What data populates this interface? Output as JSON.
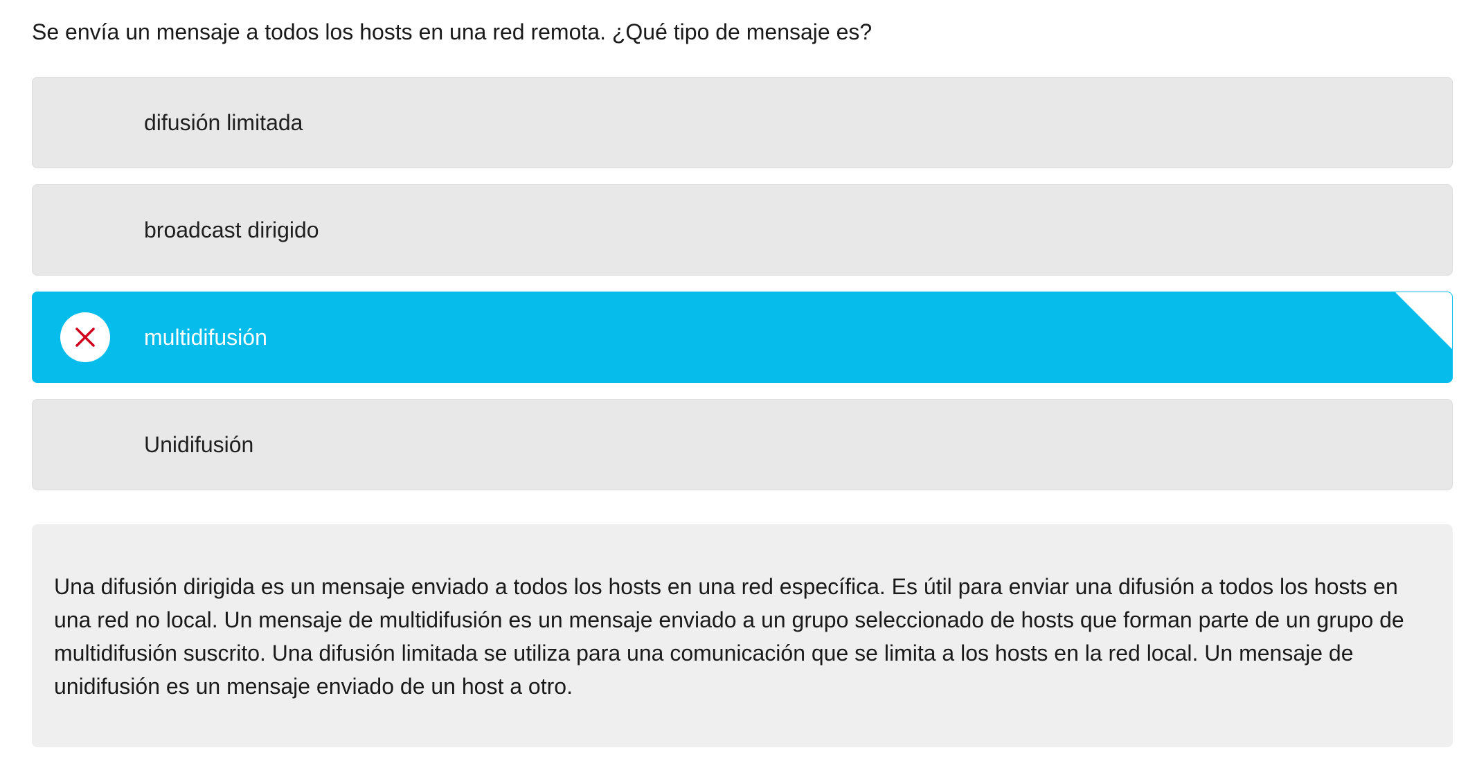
{
  "question": {
    "text": "Se envía un mensaje a todos los hosts en una red remota. ¿Qué tipo de mensaje es?"
  },
  "options": [
    {
      "label": "difusión limitada",
      "selected": false
    },
    {
      "label": "broadcast dirigido",
      "selected": false
    },
    {
      "label": "multidifusión",
      "selected": true,
      "marker_icon": "incorrect-x-icon"
    },
    {
      "label": "Unidifusión",
      "selected": false
    }
  ],
  "feedback": {
    "text": "Una difusión dirigida es un mensaje enviado a todos los hosts en una red específica. Es útil para enviar una difusión a todos los hosts en una red no local. Un mensaje de multidifusión es un mensaje enviado a un grupo seleccionado de hosts que forman parte de un grupo de multidifusión suscrito. Una difusión limitada se utiliza para una comunicación que se limita a los hosts en la red local. Un mensaje de unidifusión es un mensaje enviado de un host a otro."
  },
  "colors": {
    "selected_option": "#05bcea",
    "option_background": "#e8e8e8",
    "incorrect_mark": "#d0021b",
    "feedback_background": "#efefef"
  }
}
